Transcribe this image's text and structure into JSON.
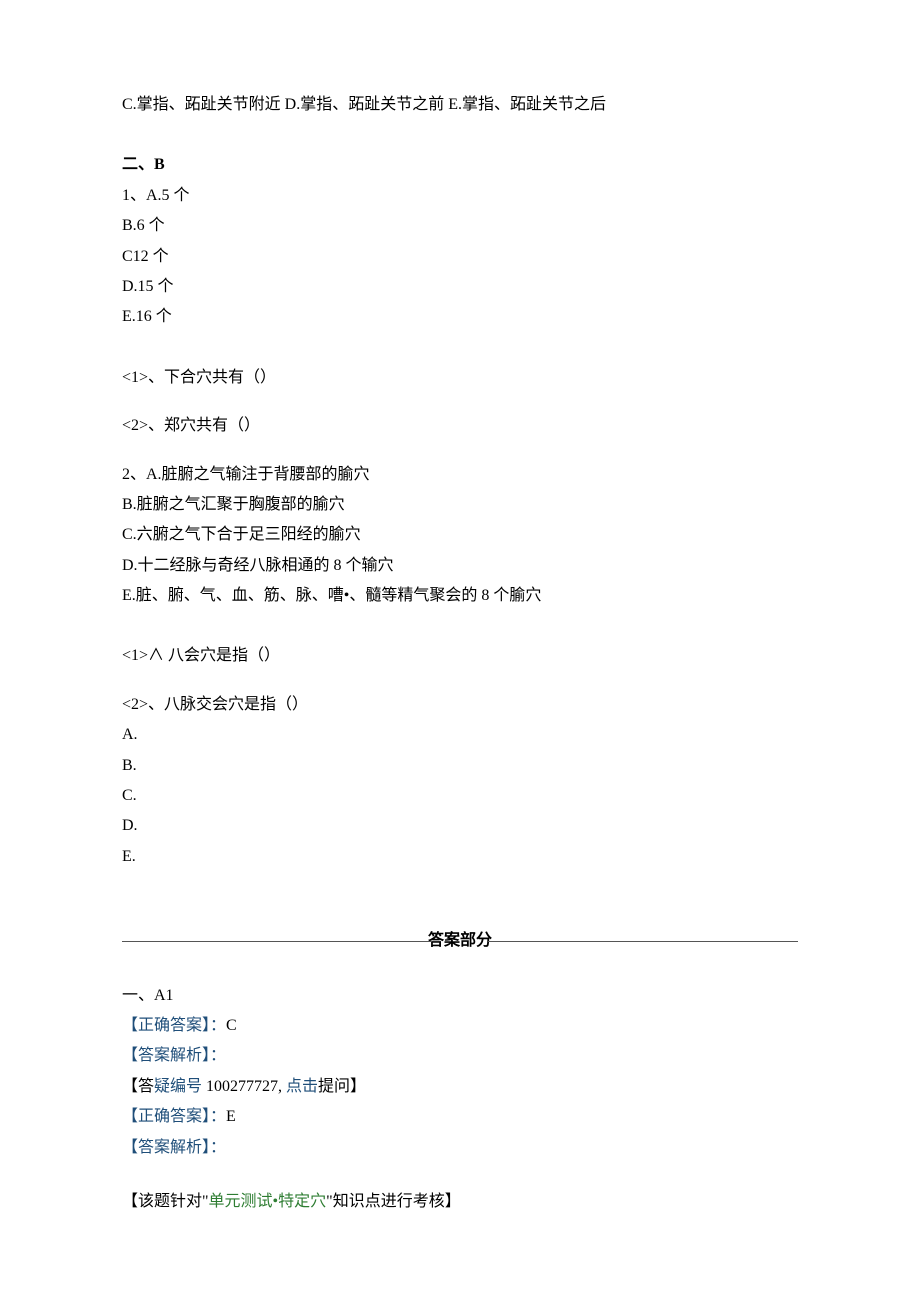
{
  "top_options_line": "C.掌指、跖趾关节附近 D.掌指、跖趾关节之前 E.掌指、跖趾关节之后",
  "sectionB": {
    "heading": "二、B",
    "q1_options": [
      "1、A.5 个",
      "B.6 个",
      "C12 个",
      "D.15 个",
      "E.16 个"
    ],
    "q1_sub1": "<1>、下合穴共有（）",
    "q1_sub2": "<2>、郑穴共有（）",
    "q2_options": [
      "2、A.脏腑之气输注于背腰部的腧穴",
      "B.脏腑之气汇聚于胸腹部的腧穴",
      "C.六腑之气下合于足三阳经的腧穴",
      "D.十二经脉与奇经八脉相通的 8 个输穴",
      "E.脏、腑、气、血、筋、脉、嘈•、髓等精气聚会的 8 个腧穴"
    ],
    "q2_sub1": "<1>∧ 八会穴是指（）",
    "q2_sub2": "<2>、八脉交会穴是指（）",
    "labels": [
      "A.",
      "B.",
      "C.",
      "D.",
      "E."
    ]
  },
  "answers_heading": "答案部分",
  "answers": {
    "section_heading": "一、A1",
    "correct_label": "【正确答案】：",
    "correct1_value": "C",
    "analysis_label": "【答案解析】：",
    "doubt_prefix": "【答",
    "doubt_mid_blue": "疑编号",
    "doubt_num": " 100277727, ",
    "doubt_click_blue": "点击",
    "doubt_suffix": "提问】",
    "correct2_value": "E",
    "note_open": "【该题针对\"",
    "note_green": "单元测试•特定穴",
    "note_close": "\"知识点进行考核】"
  }
}
